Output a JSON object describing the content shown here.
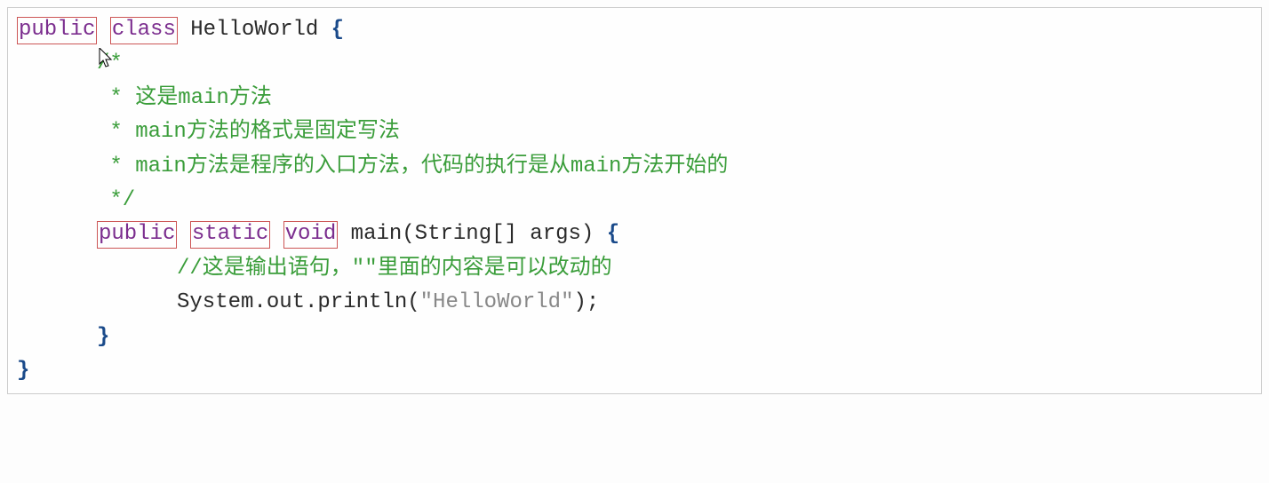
{
  "code": {
    "line1": {
      "kw_public": "public",
      "kw_class": "class",
      "rest": " HelloWorld ",
      "brace": "{"
    },
    "line2": {
      "text": "/*"
    },
    "line3": {
      "text": " * 这是main方法"
    },
    "line4": {
      "text": " * main方法的格式是固定写法"
    },
    "line5": {
      "text": " * main方法是程序的入口方法，代码的执行是从main方法开始的"
    },
    "line6": {
      "text": " */"
    },
    "line7": {
      "kw_public": "public",
      "kw_static": "static",
      "kw_void": "void",
      "rest": " main(String[] args) ",
      "brace": "{"
    },
    "line8": {
      "text": "//这是输出语句，\"\"里面的内容是可以改动的"
    },
    "line9": {
      "prefix": "System.out.println(",
      "string": "\"HelloWorld\"",
      "suffix": ");"
    },
    "line10": {
      "brace": "}"
    },
    "line11": {
      "brace": "}"
    }
  }
}
